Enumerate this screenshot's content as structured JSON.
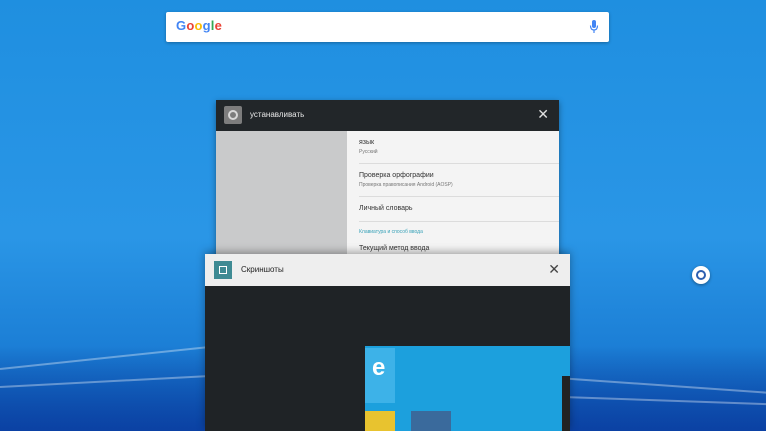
{
  "search": {
    "logo_letters": [
      "G",
      "o",
      "o",
      "g",
      "l",
      "e"
    ],
    "mic_icon": "mic-icon"
  },
  "settings_card": {
    "title": "устанавливать",
    "icon": "gear-icon",
    "items": [
      {
        "title": "язык",
        "subtitle": "Русский"
      },
      {
        "title": "Проверка орфографии",
        "subtitle": "Проверка правописания Android (AOSP)"
      },
      {
        "title": "Личный словарь",
        "subtitle": ""
      },
      {
        "title": "Клавиатура и способ ввода",
        "subtitle": ""
      },
      {
        "title": "Текущий метод ввода",
        "subtitle": ""
      }
    ]
  },
  "screenshots_card": {
    "title": "Скриншоты",
    "icon": "crop-icon"
  },
  "colors": {
    "desktop": "#1f8fe0",
    "header_dark": "#222629",
    "accent": "#3e8a93"
  }
}
